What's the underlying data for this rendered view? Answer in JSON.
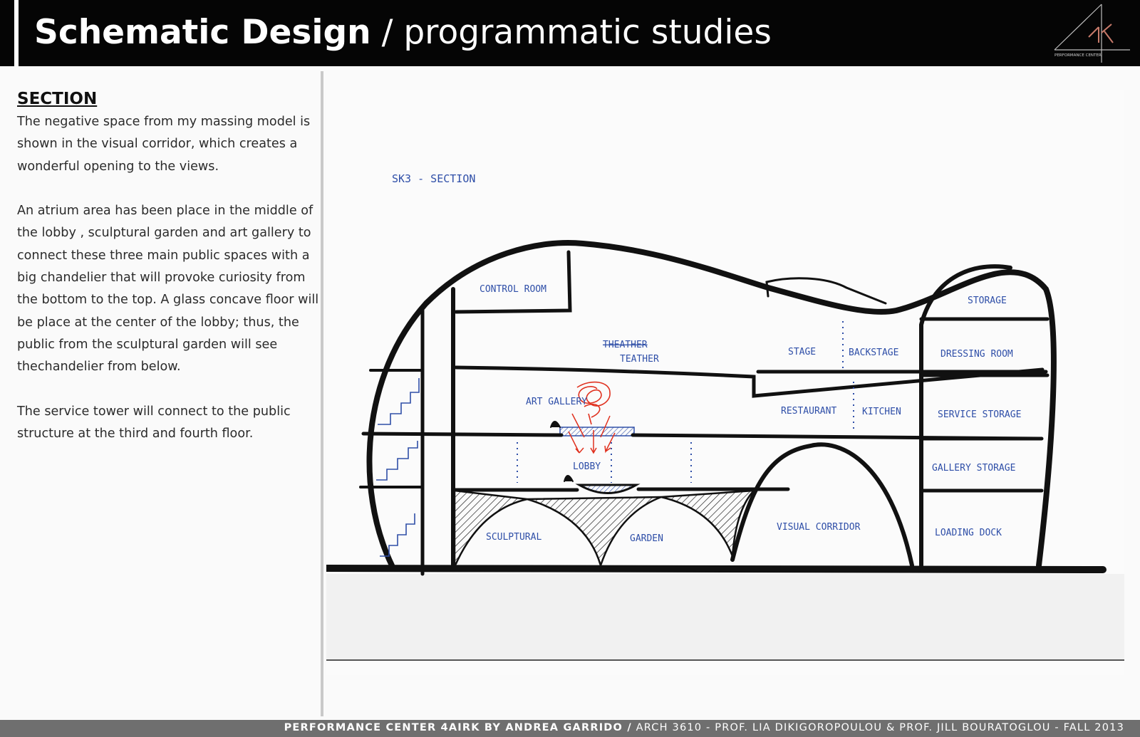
{
  "header": {
    "title_bold": "Schematic Design",
    "title_rest": "/ programmatic studies",
    "logo_text": "PERFORMANCE CENTER"
  },
  "section": {
    "heading": "SECTION",
    "paragraphs": [
      "The negative space from my massing model is shown in the visual corridor, which creates a wonderful opening to the views.",
      "An atrium area has been place in the middle of the lobby , sculptural garden and art gallery to connect these three main public spaces with a big chandelier that will provoke curiosity from the bottom to the top. A glass concave floor will be place at the center of the lobby; thus, the public from the sculptural garden will see thechandelier from below.",
      "The service tower will connect to the public structure at the third and fourth floor."
    ]
  },
  "sketch": {
    "title": "SK3 - SECTION",
    "labels": {
      "control_room": "CONTROL ROOM",
      "teather_struck": "THEATHER",
      "teather": "TEATHER",
      "stage": "STAGE",
      "backstage": "BACKSTAGE",
      "storage": "STORAGE",
      "dressing_room": "DRESSING ROOM",
      "art_gallery": "ART GALLERY",
      "restaurant": "RESTAURANT",
      "kitchen": "KITCHEN",
      "service_storage": "SERVICE STORAGE",
      "lobby": "LOBBY",
      "gallery_storage": "GALLERY STORAGE",
      "sculptural": "SCULPTURAL",
      "garden": "GARDEN",
      "visual_corridor": "VISUAL CORRIDOR",
      "loading_dock": "LOADING DOCK"
    },
    "colors": {
      "ink": "#111111",
      "pen": "#2f4fa8",
      "red": "#e0311f"
    }
  },
  "footer": {
    "bold": "PERFORMANCE CENTER 4AIRK BY ANDREA GARRIDO /",
    "rest": "ARCH 3610 - PROF. LIA DIKIGOROPOULOU & PROF. JILL BOURATOGLOU - FALL 2013"
  }
}
